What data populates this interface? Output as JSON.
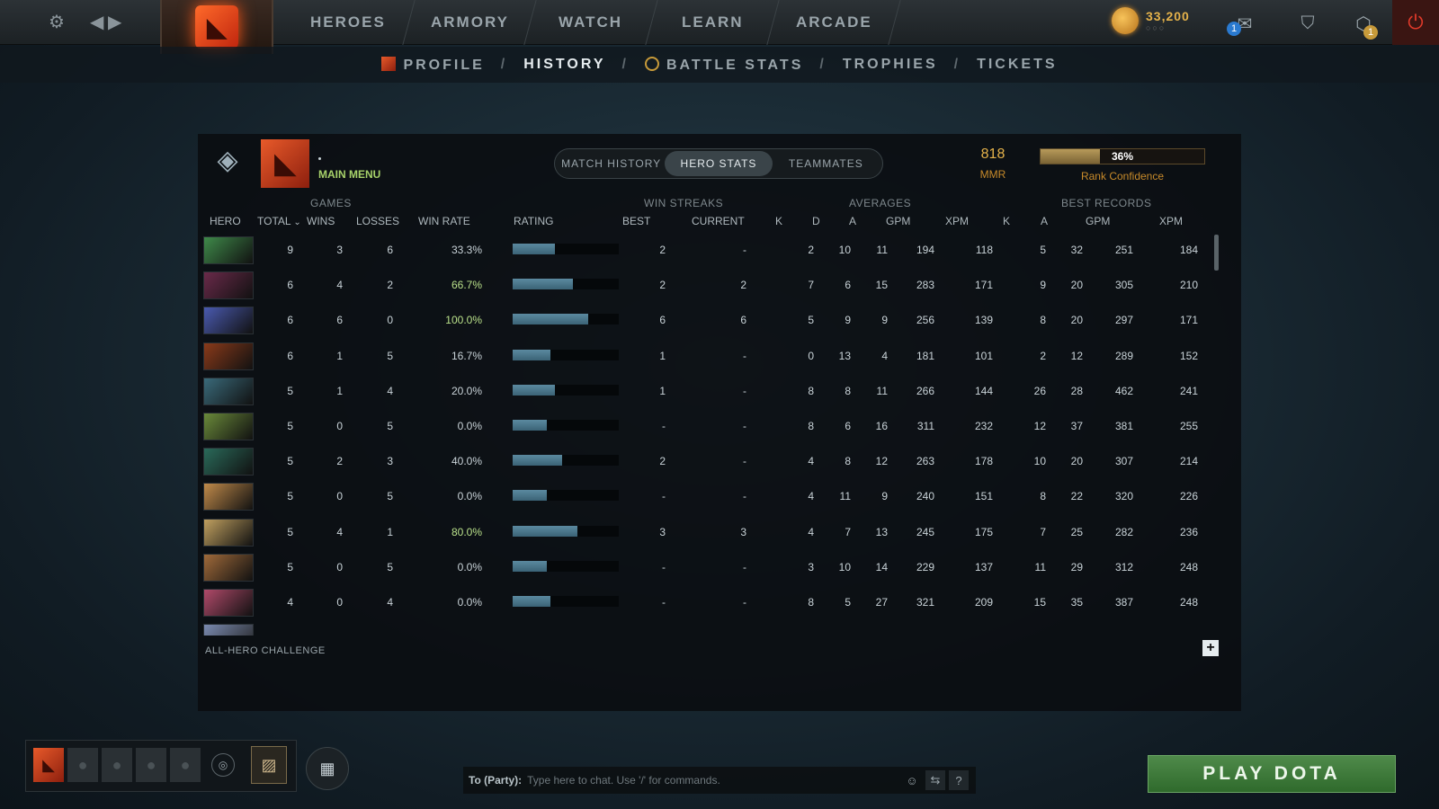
{
  "topbar": {
    "nav": [
      "HEROES",
      "ARMORY",
      "WATCH",
      "LEARN",
      "ARCADE"
    ],
    "shards_value": "33,200",
    "shards_sub": "○○○",
    "notification_count": "1",
    "level_badge": "1"
  },
  "subnav": {
    "items": [
      "PROFILE",
      "HISTORY",
      "BATTLE STATS",
      "TROPHIES",
      "TICKETS"
    ],
    "separator": "/",
    "active": "HISTORY"
  },
  "profile": {
    "player_name": "•",
    "main_menu_label": "MAIN MENU",
    "mmr_value": "818",
    "mmr_label": "MMR",
    "rank_confidence_text": "36%",
    "rank_confidence_value": 0.36,
    "rank_confidence_label": "Rank Confidence"
  },
  "tabs": [
    "MATCH HISTORY",
    "HERO STATS",
    "TEAMMATES"
  ],
  "active_tab": "HERO STATS",
  "table": {
    "groups": {
      "games": "GAMES",
      "win_streaks": "WIN STREAKS",
      "averages": "AVERAGES",
      "best_records": "BEST RECORDS"
    },
    "columns": {
      "hero": "HERO",
      "total": "TOTAL",
      "wins": "WINS",
      "losses": "LOSSES",
      "win_rate": "WIN RATE",
      "rating": "RATING",
      "best": "BEST",
      "current": "CURRENT",
      "avg_k": "K",
      "avg_d": "D",
      "avg_a": "A",
      "avg_gpm": "GPM",
      "avg_xpm": "XPM",
      "best_k": "K",
      "best_a": "A",
      "best_gpm": "GPM",
      "best_xpm": "XPM"
    },
    "rows": [
      {
        "total": "9",
        "wins": "3",
        "losses": "6",
        "win_rate": "33.3%",
        "rating": 0.4,
        "best": "2",
        "current": "-",
        "k": "2",
        "d": "10",
        "a": "11",
        "gpm": "194",
        "xpm": "118",
        "bk": "5",
        "ba": "32",
        "bgpm": "251",
        "bxpm": "184"
      },
      {
        "total": "6",
        "wins": "4",
        "losses": "2",
        "win_rate": "66.7%",
        "rating": 0.57,
        "best": "2",
        "current": "2",
        "k": "7",
        "d": "6",
        "a": "15",
        "gpm": "283",
        "xpm": "171",
        "bk": "9",
        "ba": "20",
        "bgpm": "305",
        "bxpm": "210"
      },
      {
        "total": "6",
        "wins": "6",
        "losses": "0",
        "win_rate": "100.0%",
        "rating": 0.71,
        "best": "6",
        "current": "6",
        "k": "5",
        "d": "9",
        "a": "9",
        "gpm": "256",
        "xpm": "139",
        "bk": "8",
        "ba": "20",
        "bgpm": "297",
        "bxpm": "171"
      },
      {
        "total": "6",
        "wins": "1",
        "losses": "5",
        "win_rate": "16.7%",
        "rating": 0.36,
        "best": "1",
        "current": "-",
        "k": "0",
        "d": "13",
        "a": "4",
        "gpm": "181",
        "xpm": "101",
        "bk": "2",
        "ba": "12",
        "bgpm": "289",
        "bxpm": "152"
      },
      {
        "total": "5",
        "wins": "1",
        "losses": "4",
        "win_rate": "20.0%",
        "rating": 0.4,
        "best": "1",
        "current": "-",
        "k": "8",
        "d": "8",
        "a": "11",
        "gpm": "266",
        "xpm": "144",
        "bk": "26",
        "ba": "28",
        "bgpm": "462",
        "bxpm": "241"
      },
      {
        "total": "5",
        "wins": "0",
        "losses": "5",
        "win_rate": "0.0%",
        "rating": 0.32,
        "best": "-",
        "current": "-",
        "k": "8",
        "d": "6",
        "a": "16",
        "gpm": "311",
        "xpm": "232",
        "bk": "12",
        "ba": "37",
        "bgpm": "381",
        "bxpm": "255"
      },
      {
        "total": "5",
        "wins": "2",
        "losses": "3",
        "win_rate": "40.0%",
        "rating": 0.47,
        "best": "2",
        "current": "-",
        "k": "4",
        "d": "8",
        "a": "12",
        "gpm": "263",
        "xpm": "178",
        "bk": "10",
        "ba": "20",
        "bgpm": "307",
        "bxpm": "214"
      },
      {
        "total": "5",
        "wins": "0",
        "losses": "5",
        "win_rate": "0.0%",
        "rating": 0.32,
        "best": "-",
        "current": "-",
        "k": "4",
        "d": "11",
        "a": "9",
        "gpm": "240",
        "xpm": "151",
        "bk": "8",
        "ba": "22",
        "bgpm": "320",
        "bxpm": "226"
      },
      {
        "total": "5",
        "wins": "4",
        "losses": "1",
        "win_rate": "80.0%",
        "rating": 0.61,
        "best": "3",
        "current": "3",
        "k": "4",
        "d": "7",
        "a": "13",
        "gpm": "245",
        "xpm": "175",
        "bk": "7",
        "ba": "25",
        "bgpm": "282",
        "bxpm": "236"
      },
      {
        "total": "5",
        "wins": "0",
        "losses": "5",
        "win_rate": "0.0%",
        "rating": 0.32,
        "best": "-",
        "current": "-",
        "k": "3",
        "d": "10",
        "a": "14",
        "gpm": "229",
        "xpm": "137",
        "bk": "11",
        "ba": "29",
        "bgpm": "312",
        "bxpm": "248"
      },
      {
        "total": "4",
        "wins": "0",
        "losses": "4",
        "win_rate": "0.0%",
        "rating": 0.36,
        "best": "-",
        "current": "-",
        "k": "8",
        "d": "5",
        "a": "27",
        "gpm": "321",
        "xpm": "209",
        "bk": "15",
        "ba": "35",
        "bgpm": "387",
        "bxpm": "248"
      }
    ],
    "hero_colors": [
      "#3f8a4a",
      "#6a2a4a",
      "#4a5ab0",
      "#8a3a1a",
      "#3a6a7a",
      "#6a8a3a",
      "#2a6a5a",
      "#c08a4a",
      "#c0a060",
      "#a06a3a",
      "#b04a6a"
    ],
    "win_rate_colors": {
      "high": "#b9e08a",
      "low": "#c9d3d8"
    },
    "footer_label": "ALL-HERO CHALLENGE",
    "plus_icon": "+"
  },
  "bottom": {
    "chat_target": "To (Party):",
    "chat_placeholder": "Type here to chat. Use '/' for commands.",
    "play_label": "PLAY DOTA"
  }
}
